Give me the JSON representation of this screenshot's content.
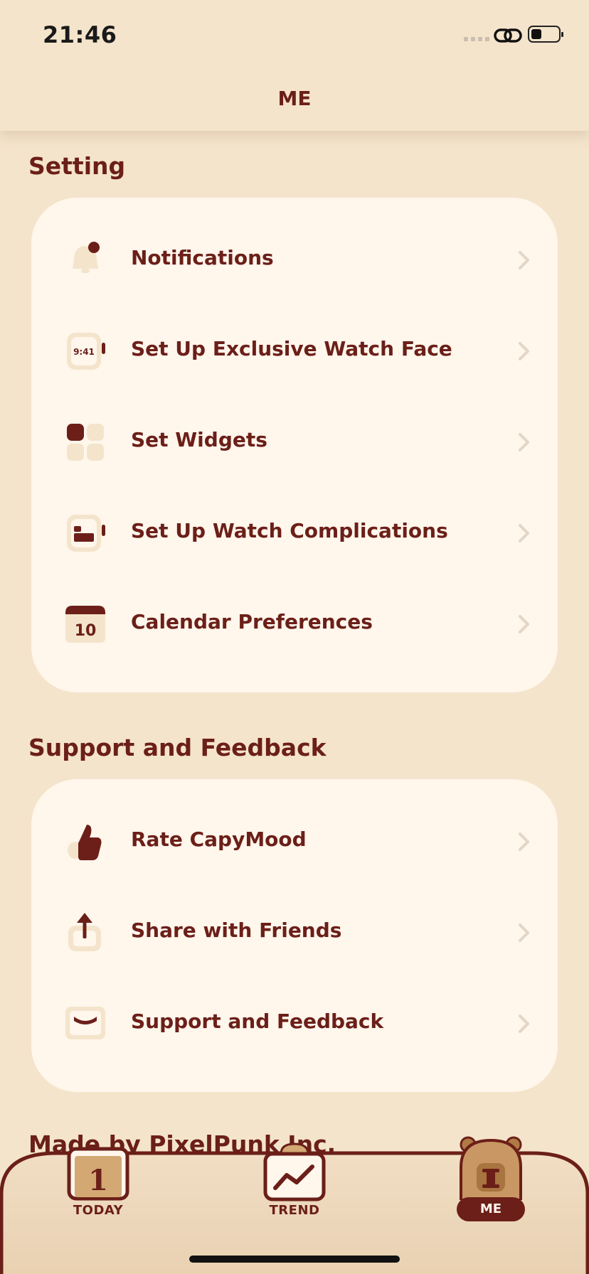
{
  "status_bar": {
    "time": "21:46"
  },
  "nav": {
    "title": "ME"
  },
  "sections": {
    "setting": {
      "title": "Setting",
      "items": [
        {
          "label": "Notifications",
          "icon": "bell-icon"
        },
        {
          "label": "Set Up Exclusive Watch Face",
          "icon": "watch-face-icon",
          "icon_text": "9:41"
        },
        {
          "label": "Set Widgets",
          "icon": "widgets-icon"
        },
        {
          "label": "Set Up Watch Complications",
          "icon": "watch-complication-icon"
        },
        {
          "label": "Calendar Preferences",
          "icon": "calendar-icon",
          "icon_text": "10"
        }
      ]
    },
    "support": {
      "title": "Support and Feedback",
      "items": [
        {
          "label": "Rate CapyMood",
          "icon": "thumbs-up-icon"
        },
        {
          "label": "Share with Friends",
          "icon": "share-icon"
        },
        {
          "label": "Support and Feedback",
          "icon": "mail-icon"
        }
      ]
    }
  },
  "footer": {
    "text": "Made by PixelPunk Inc."
  },
  "tabs": [
    {
      "label": "TODAY",
      "icon": "calendar-tab-icon",
      "icon_text": "1"
    },
    {
      "label": "TREND",
      "icon": "trend-tab-icon"
    },
    {
      "label": "ME",
      "icon": "capybara-tab-icon",
      "active": true
    }
  ],
  "colors": {
    "background": "#F4E4CB",
    "card": "#FFF6EC",
    "text": "#6B1F18",
    "icon_light": "#F4E4CB"
  }
}
